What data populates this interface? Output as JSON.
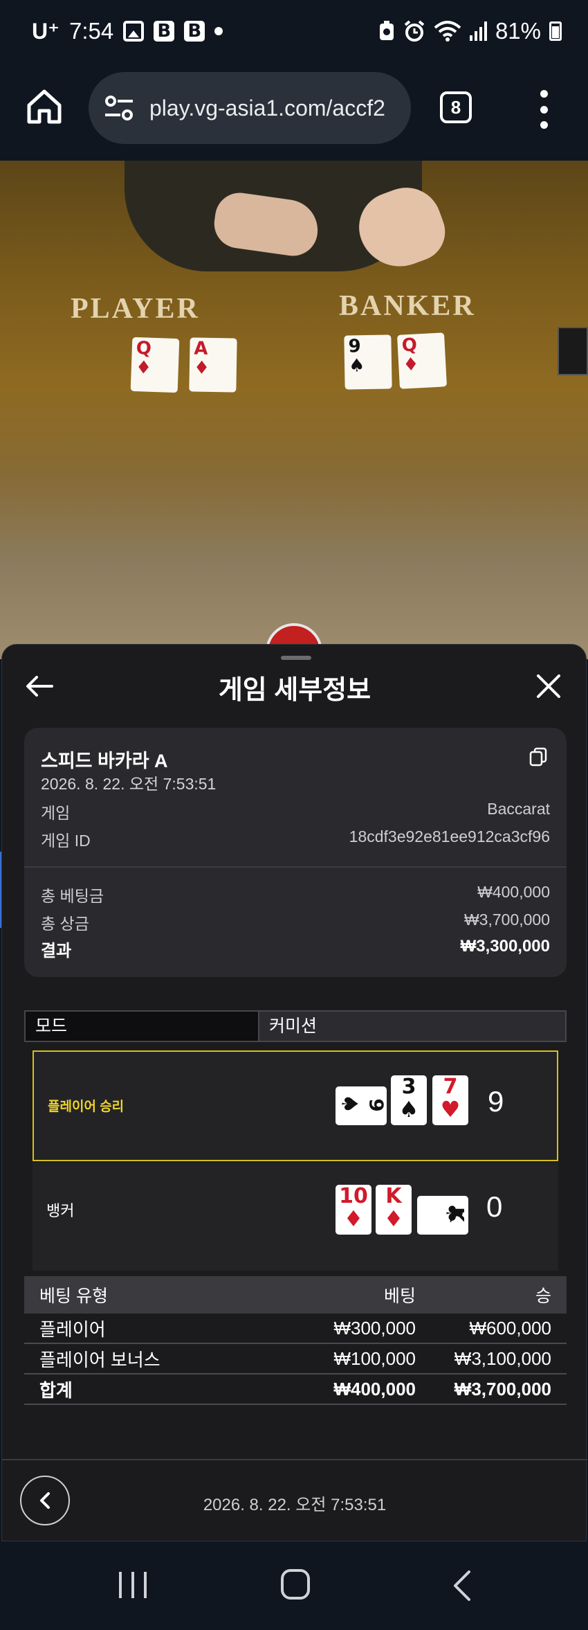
{
  "status_bar": {
    "carrier": "U⁺",
    "time": "7:54",
    "battery": "81%",
    "icons": [
      "image-icon",
      "b-app-icon",
      "b-app-icon",
      "dot-icon",
      "recycle-icon",
      "alarm-icon",
      "wifi-icon",
      "signal-icon",
      "battery-icon"
    ]
  },
  "browser": {
    "url": "play.vg-asia1.com/accf2",
    "tab_count": "8"
  },
  "video": {
    "player_label": "PLAYER",
    "banker_label": "BANKER",
    "player_cards": [
      "Q",
      "A"
    ],
    "banker_cards": [
      "9",
      "Q"
    ],
    "player_cards_suits": [
      "♦",
      "♦"
    ],
    "banker_cards_suits": [
      "♠",
      "♦"
    ]
  },
  "sheet": {
    "title": "게임 세부정보",
    "game_name": "스피드 바카라 A",
    "datetime": "2026. 8. 22. 오전 7:53:51",
    "game_label": "게임",
    "game_value": "Baccarat",
    "game_id_label": "게임 ID",
    "game_id_value": "18cdf3e92e81ee912ca3cf96",
    "total_bet_label": "총 베팅금",
    "total_bet_value": "₩400,000",
    "total_win_label": "총 상금",
    "total_win_value": "₩3,700,000",
    "result_label": "결과",
    "result_value": "₩3,300,000",
    "tabs": {
      "mode": "모드",
      "commission": "커미션"
    },
    "player_hand": {
      "label": "플레이어 승리",
      "score": "9",
      "cards": [
        {
          "rank": "9",
          "suit": "♠",
          "color": "black"
        },
        {
          "rank": "3",
          "suit": "♠",
          "color": "black"
        },
        {
          "rank": "7",
          "suit": "♥",
          "color": "red"
        }
      ]
    },
    "banker_hand": {
      "label": "뱅커",
      "score": "0",
      "cards": [
        {
          "rank": "10",
          "suit": "♦",
          "color": "red"
        },
        {
          "rank": "K",
          "suit": "♦",
          "color": "red"
        },
        {
          "rank": "K",
          "suit": "♣",
          "color": "black"
        }
      ]
    },
    "bet_table": {
      "headers": [
        "베팅 유형",
        "베팅",
        "승"
      ],
      "rows": [
        [
          "플레이어",
          "₩300,000",
          "₩600,000"
        ],
        [
          "플레이어 보너스",
          "₩100,000",
          "₩3,100,000"
        ]
      ],
      "total": [
        "합계",
        "₩400,000",
        "₩3,700,000"
      ]
    },
    "footer_datetime": "2026. 8. 22. 오전 7:53:51"
  },
  "colors": {
    "win_border": "#d6c21a",
    "win_label": "#f0d52a",
    "sheet_bg": "#1b1b1d",
    "card_red": "#d11a2a",
    "trophy_tab": "#3a72d6"
  }
}
